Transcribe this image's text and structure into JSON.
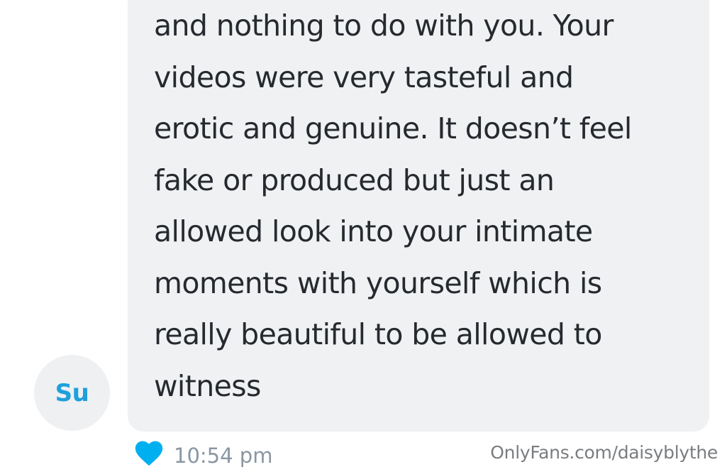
{
  "message": {
    "lines": [
      "and nothing to do with you. Your",
      "videos were very tasteful and",
      "erotic and genuine. It doesn’t feel",
      "fake or produced but just an",
      "allowed look into your intimate",
      "moments with yourself which is",
      "really beautiful to be allowed to",
      "witness"
    ],
    "timestamp": "10:54 pm",
    "liked": true
  },
  "sender": {
    "initials": "Su"
  },
  "watermark": "OnlyFans.com/daisyblythe",
  "colors": {
    "bubble_bg": "#f0f1f3",
    "text": "#262a2f",
    "accent": "#1fa0dc",
    "heart": "#00aff0",
    "timestamp": "#8a96a3",
    "watermark": "#7a7d80"
  },
  "icons": {
    "like": "heart-icon"
  }
}
